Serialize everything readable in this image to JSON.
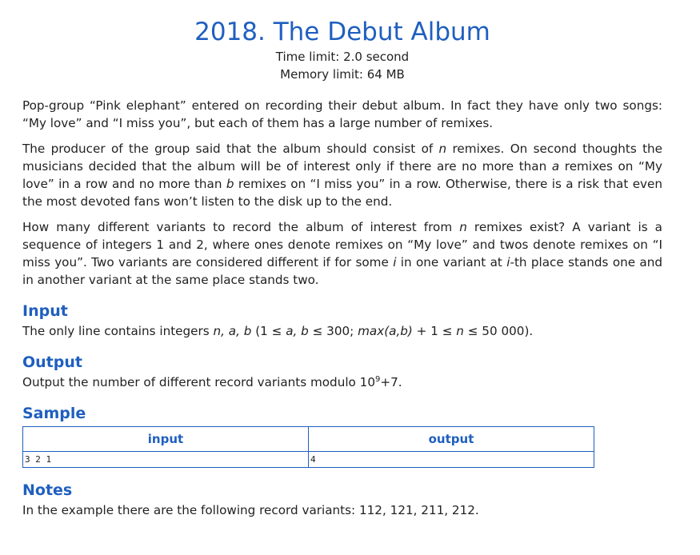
{
  "title": "2018. The Debut Album",
  "limits": {
    "time": "Time limit: 2.0 second",
    "memory": "Memory limit: 64 MB"
  },
  "statement": {
    "p1": "Pop-group “Pink elephant” entered on recording their debut album. In fact they have only two songs: “My love” and “I miss you”, but each of them has a large number of remixes.",
    "p2": {
      "a": "The producer of the group said that the album should consist of ",
      "n": "n",
      "b": " remixes. On second thoughts the musicians decided that the album will be of interest only if there are no more than ",
      "a_var": "a",
      "c": " remixes on “My love” in a row and no more than ",
      "b_var": "b",
      "d": " remixes on “I miss you” in a row. Otherwise, there is a risk that even the most devoted fans won’t listen to the disk up to the end."
    },
    "p3": {
      "a": "How many different variants to record the album of interest from ",
      "n": "n",
      "b": " remixes exist? A variant is a sequence of integers 1 and 2, where ones denote remixes on “My love” and twos denote remixes on “I miss you”. Two variants are considered different if for some ",
      "i1": "i",
      "c": " in one variant at ",
      "i2": "i",
      "d": "-th place stands one and in another variant at the same place stands two."
    }
  },
  "input": {
    "heading": "Input",
    "t1": "The only line contains integers ",
    "vars": "n, a, b",
    "t2": " (1 ≤ ",
    "v2": "a, b",
    "t3": " ≤ 300; ",
    "v3": "max(a,b)",
    "t4": " + 1 ≤ ",
    "v4": "n",
    "t5": " ≤ 50 000)."
  },
  "output": {
    "heading": "Output",
    "t1": "Output the number of different record variants modulo 10",
    "exp": "9",
    "t2": "+7."
  },
  "sample": {
    "heading": "Sample",
    "col_input": "input",
    "col_output": "output",
    "input_value": "3 2 1",
    "output_value": "4"
  },
  "notes": {
    "heading": "Notes",
    "text": "In the example there are the following record variants: 112, 121, 211, 212."
  }
}
